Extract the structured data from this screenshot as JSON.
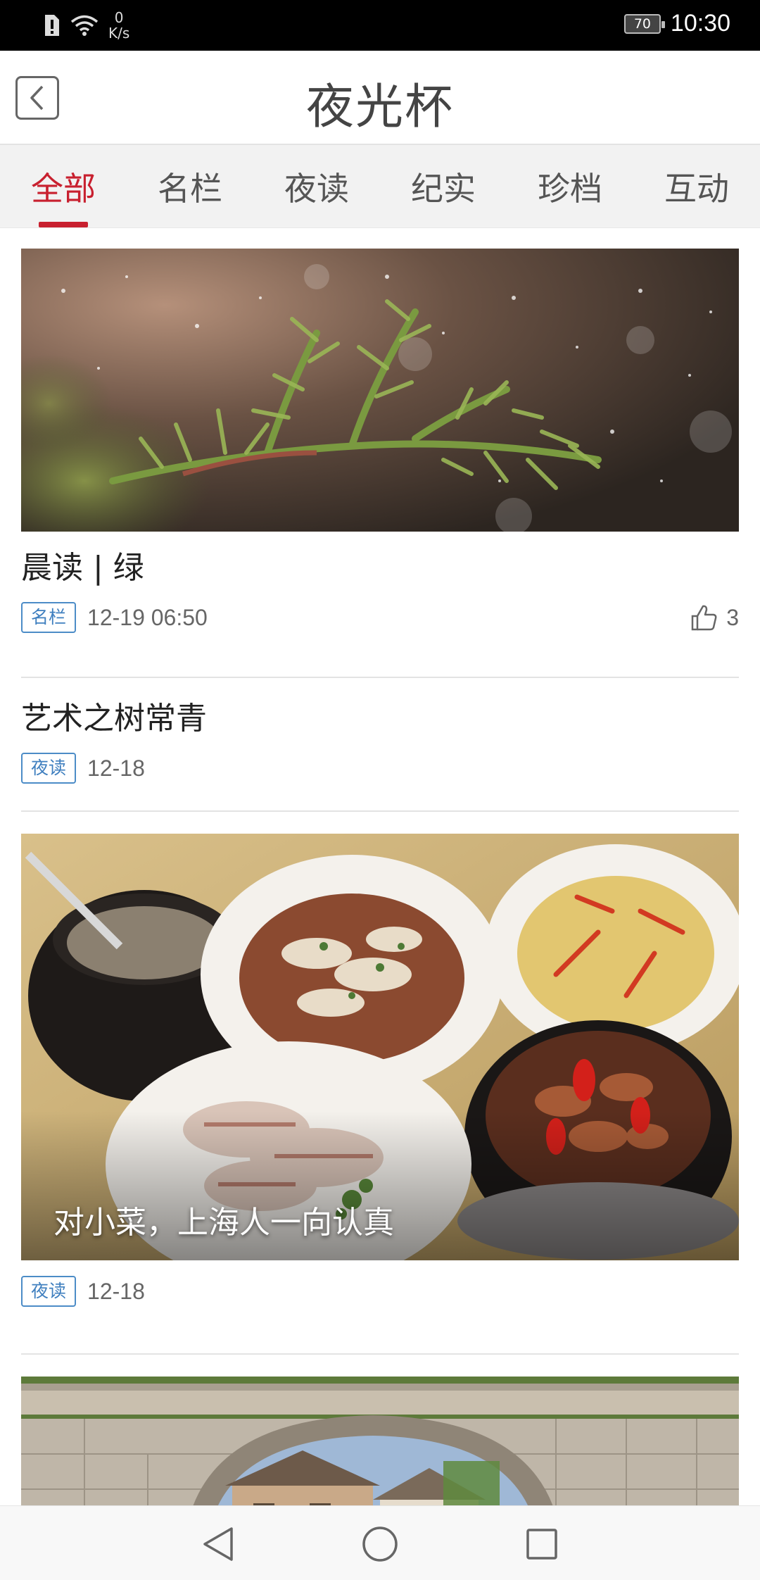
{
  "status_bar": {
    "speed_value": "0",
    "speed_unit": "K/s",
    "battery": "70",
    "time": "10:30"
  },
  "header": {
    "title": "夜光杯"
  },
  "tabs": [
    {
      "label": "全部",
      "active": true
    },
    {
      "label": "名栏",
      "active": false
    },
    {
      "label": "夜读",
      "active": false
    },
    {
      "label": "纪实",
      "active": false
    },
    {
      "label": "珍档",
      "active": false
    },
    {
      "label": "互动",
      "active": false
    }
  ],
  "feed": [
    {
      "title": "晨读 | 绿",
      "tag": "名栏",
      "date": "12-19 06:50",
      "likes": "3",
      "image": "evergreen-branch-snow"
    },
    {
      "title": "艺术之树常青",
      "tag": "夜读",
      "date": "12-18"
    },
    {
      "title": "对小菜，上海人一向认真",
      "tag": "夜读",
      "date": "12-18",
      "image": "shanghai-dishes"
    },
    {
      "image": "stone-arch-bridge"
    }
  ],
  "colors": {
    "accent": "#c8202f",
    "tag_blue": "#3f7fbf"
  }
}
